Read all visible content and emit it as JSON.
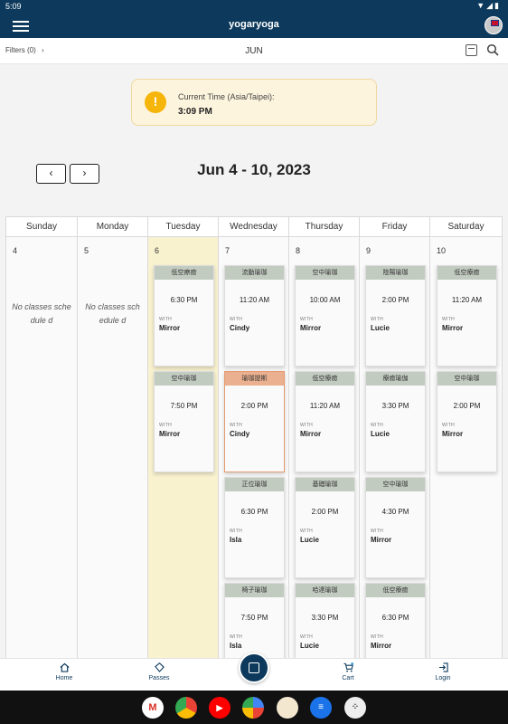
{
  "status_bar": {
    "time": "5:09",
    "icons": "▼◢▮"
  },
  "app_bar": {
    "title": "yogaryoga"
  },
  "toolbar": {
    "filters_label": "Filters (0)",
    "filters_chevron": "›",
    "month": "JUN"
  },
  "current_time": {
    "label": "Current Time (Asia/Taipei):",
    "value": "3:09 PM"
  },
  "week": {
    "prev": "‹",
    "next": "›",
    "range": "Jun 4 - 10, 2023"
  },
  "days": [
    {
      "name": "Sunday",
      "num": "4",
      "no_classes": "No classes schedule d"
    },
    {
      "name": "Monday",
      "num": "5",
      "no_classes": "No classes schedule d"
    },
    {
      "name": "Tuesday",
      "num": "6"
    },
    {
      "name": "Wednesday",
      "num": "7"
    },
    {
      "name": "Thursday",
      "num": "8"
    },
    {
      "name": "Friday",
      "num": "9"
    },
    {
      "name": "Saturday",
      "num": "10"
    }
  ],
  "with_label": "WITH",
  "classes": {
    "tue": [
      {
        "title": "低空瘵癒",
        "time": "6:30 PM",
        "teacher": "Mirror"
      },
      {
        "title": "空中瑜珈",
        "time": "7:50 PM",
        "teacher": "Mirror"
      }
    ],
    "wed": [
      {
        "title": "流動瑜珈",
        "time": "11:20 AM",
        "teacher": "Cindy"
      },
      {
        "title": "瑜珈提斯",
        "time": "2:00 PM",
        "teacher": "Cindy"
      },
      {
        "title": "正位瑜珈",
        "time": "6:30 PM",
        "teacher": "Isla"
      },
      {
        "title": "椅子瑜珈",
        "time": "7:50 PM",
        "teacher": "Isla"
      }
    ],
    "thu": [
      {
        "title": "空中瑜珈",
        "time": "10:00 AM",
        "teacher": "Mirror"
      },
      {
        "title": "低空療癒",
        "time": "11:20 AM",
        "teacher": "Mirror"
      },
      {
        "title": "基礎瑜珈",
        "time": "2:00 PM",
        "teacher": "Lucie"
      },
      {
        "title": "哈達瑜珈",
        "time": "3:30 PM",
        "teacher": "Lucie"
      }
    ],
    "fri": [
      {
        "title": "陰陽瑜珈",
        "time": "2:00 PM",
        "teacher": "Lucie"
      },
      {
        "title": "療癒瑜伽",
        "time": "3:30 PM",
        "teacher": "Lucie"
      },
      {
        "title": "空中瑜珈",
        "time": "4:30 PM",
        "teacher": "Mirror"
      },
      {
        "title": "低空療癒",
        "time": "6:30 PM",
        "teacher": "Mirror"
      }
    ],
    "sat": [
      {
        "title": "低空療癒",
        "time": "11:20 AM",
        "teacher": "Mirror"
      },
      {
        "title": "空中瑜珈",
        "time": "2:00 PM",
        "teacher": "Mirror"
      }
    ]
  },
  "bottom_nav": {
    "home": "Home",
    "passes": "Passes",
    "cart": "Cart",
    "login": "Login"
  },
  "dock_apps": [
    "gmail-icon",
    "chrome-icon",
    "youtube-icon",
    "photos-icon",
    "app-icon",
    "messages-icon",
    "apps-grid-icon"
  ],
  "colors": {
    "primary": "#0d3a5c",
    "today": "#f9f2cf",
    "card_header": "#c2cbc0",
    "highlight_header": "#eab08f",
    "time_box": "#fdf4dd",
    "clock": "#f5b50a"
  }
}
